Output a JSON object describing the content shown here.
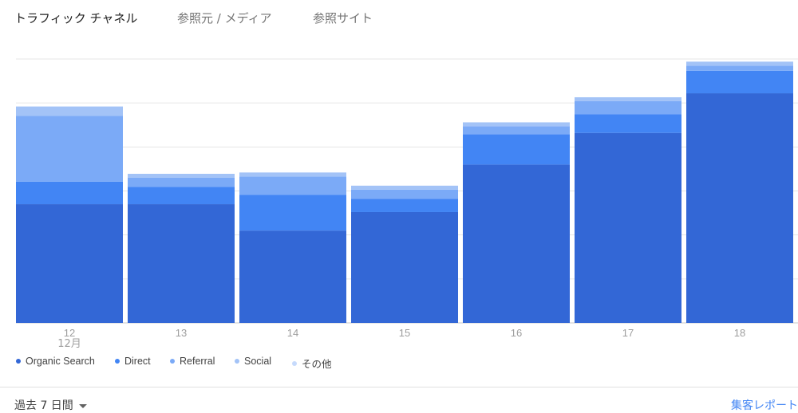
{
  "tabs": [
    {
      "label": "トラフィック チャネル",
      "active": true
    },
    {
      "label": "参照元 / メディア",
      "active": false
    },
    {
      "label": "参照サイト",
      "active": false
    }
  ],
  "colors": {
    "organic": "#3367d6",
    "direct": "#4285f4",
    "referral": "#7baaf7",
    "social": "#a3c3f7",
    "other": "#c6dafc",
    "grid": "#e6e6e6",
    "tick": "#9e9e9e",
    "link": "#4285f4"
  },
  "chart_data": {
    "type": "bar",
    "stacked": true,
    "categories": [
      "12",
      "13",
      "14",
      "15",
      "16",
      "17",
      "18"
    ],
    "x_sublabel": "12月",
    "ylim": [
      0,
      100
    ],
    "grid": true,
    "legend_position": "bottom-left",
    "series": [
      {
        "name": "Organic Search",
        "color": "#3367d6",
        "values": [
          45,
          45,
          35,
          42,
          60,
          72,
          87
        ]
      },
      {
        "name": "Direct",
        "color": "#4285f4",
        "values": [
          8.5,
          6.5,
          13.5,
          5,
          11.5,
          7,
          8.5
        ]
      },
      {
        "name": "Referral",
        "color": "#7baaf7",
        "values": [
          25,
          3.5,
          7,
          3.5,
          3,
          5,
          2
        ]
      },
      {
        "name": "Social",
        "color": "#a3c3f7",
        "values": [
          3.5,
          1.5,
          1.5,
          1.5,
          1.5,
          1.5,
          1.5
        ]
      },
      {
        "name": "その他",
        "color": "#c6dafc",
        "values": [
          0,
          0,
          0,
          0,
          0,
          0,
          0
        ]
      }
    ]
  },
  "footer": {
    "period_label": "過去 7 日間",
    "report_link": "集客レポート"
  }
}
